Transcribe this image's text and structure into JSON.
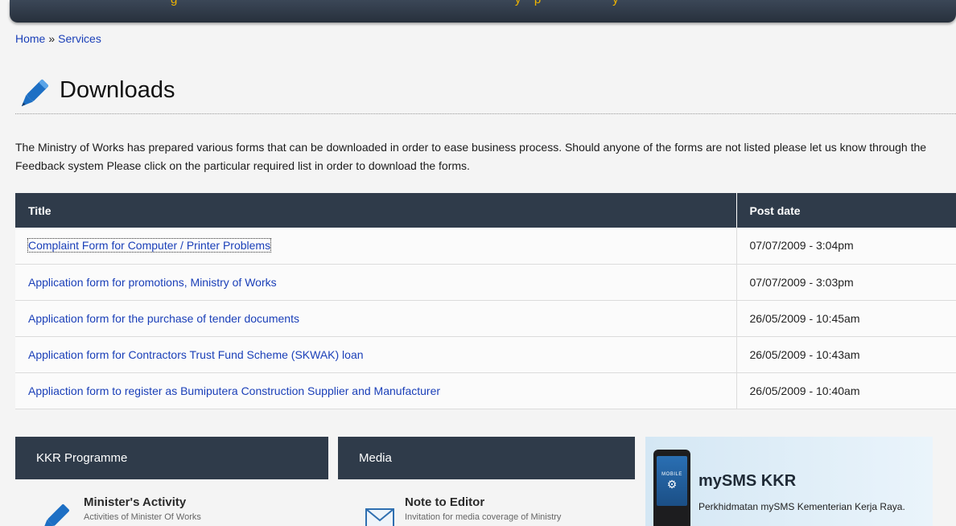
{
  "breadcrumb": {
    "home": "Home",
    "separator": "»",
    "current": "Services"
  },
  "page": {
    "title": "Downloads",
    "intro": "The Ministry of Works has prepared various forms that can be downloaded in order to ease business process. Should anyone of the forms are not listed please let us know through the Feedback system Please click on the particular required list in order to download the forms."
  },
  "table": {
    "headers": {
      "title": "Title",
      "date": "Post date"
    },
    "rows": [
      {
        "title": "Complaint Form for Computer / Printer Problems",
        "date": "07/07/2009 - 3:04pm"
      },
      {
        "title": "Application form for promotions, Ministry of Works",
        "date": "07/07/2009 - 3:03pm"
      },
      {
        "title": "Application form for the purchase of tender documents",
        "date": "26/05/2009 - 10:45am"
      },
      {
        "title": "Application form for Contractors Trust Fund Scheme (SKWAK) loan",
        "date": "26/05/2009 - 10:43am"
      },
      {
        "title": "Appliaction form to register as Bumiputera Construction Supplier and Manufacturer",
        "date": "26/05/2009 - 10:40am"
      }
    ]
  },
  "panels": {
    "kkr": {
      "heading": "KKR Programme",
      "item_title": "Minister's Activity",
      "item_sub": "Activities of Minister Of Works"
    },
    "media": {
      "heading": "Media",
      "item_title": "Note to Editor",
      "item_sub": "Invitation for media coverage of Ministry"
    }
  },
  "sms": {
    "screen_label": "MOBILE",
    "title": "mySMS KKR",
    "desc": "Perkhidmatan mySMS Kementerian Kerja Raya."
  },
  "icons": {
    "heading": "pencil-icon",
    "kkr_item": "pencil-icon",
    "media_item": "envelope-icon",
    "sms": "mobile-phone-icon"
  },
  "colors": {
    "header_dark": "#2f3b4a",
    "link": "#1a3fb8",
    "pencil_blue": "#1d6fc4",
    "topbar_text": "#f0b400"
  }
}
